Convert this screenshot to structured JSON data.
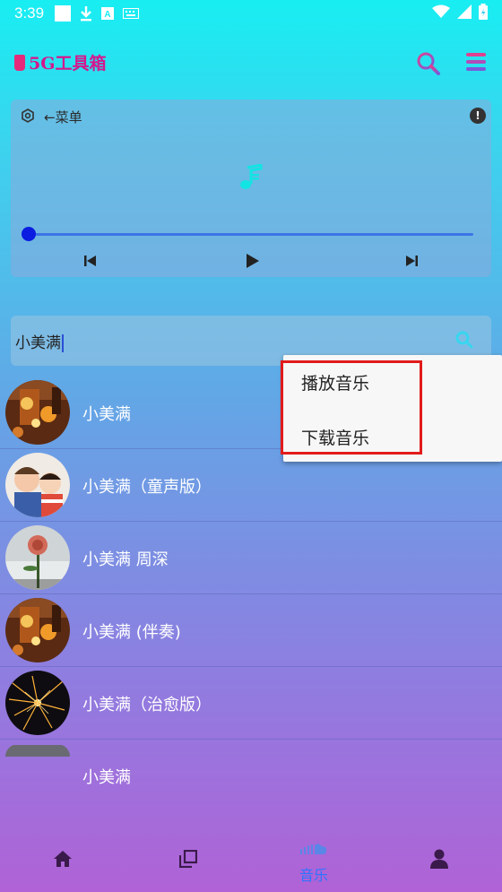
{
  "status_bar": {
    "time": "3:39",
    "icons": [
      "white-square-icon",
      "download-icon",
      "a-icon",
      "keyboard-icon",
      "wifi-icon",
      "signal-icon",
      "battery-icon"
    ]
  },
  "app": {
    "title": "5G工具箱",
    "title_color": "#d4188c",
    "actions": [
      "search-icon",
      "menu-icon"
    ]
  },
  "player": {
    "menu_label": "←菜单",
    "info_icon_text": "!",
    "icons": [
      "settings-icon",
      "info-icon",
      "music-note-icon",
      "skip-previous-icon",
      "play-icon",
      "skip-next-icon"
    ],
    "accent": "#3b74e6",
    "progress": 0
  },
  "search": {
    "value": "小美满",
    "icon": "search-icon"
  },
  "results": [
    {
      "title": "小美满",
      "thumb": "lantern-photo"
    },
    {
      "title": "小美满（童声版）",
      "thumb": "children-photo"
    },
    {
      "title": "小美满 周深",
      "thumb": "rose-photo"
    },
    {
      "title": "小美满 (伴奏)",
      "thumb": "lantern-photo"
    },
    {
      "title": "小美满（治愈版）",
      "thumb": "sparkler-photo"
    },
    {
      "title": "小美满",
      "thumb": "gray-photo"
    }
  ],
  "context_menu": {
    "items": [
      "播放音乐",
      "下载音乐"
    ],
    "highlight_color": "#e21b1b"
  },
  "bottom_nav": {
    "items": [
      {
        "icon": "home-icon",
        "label": ""
      },
      {
        "icon": "copy-icon",
        "label": ""
      },
      {
        "icon": "soundcloud-icon",
        "label": "音乐"
      },
      {
        "icon": "person-icon",
        "label": ""
      }
    ],
    "active_color": "#2e74ff"
  }
}
